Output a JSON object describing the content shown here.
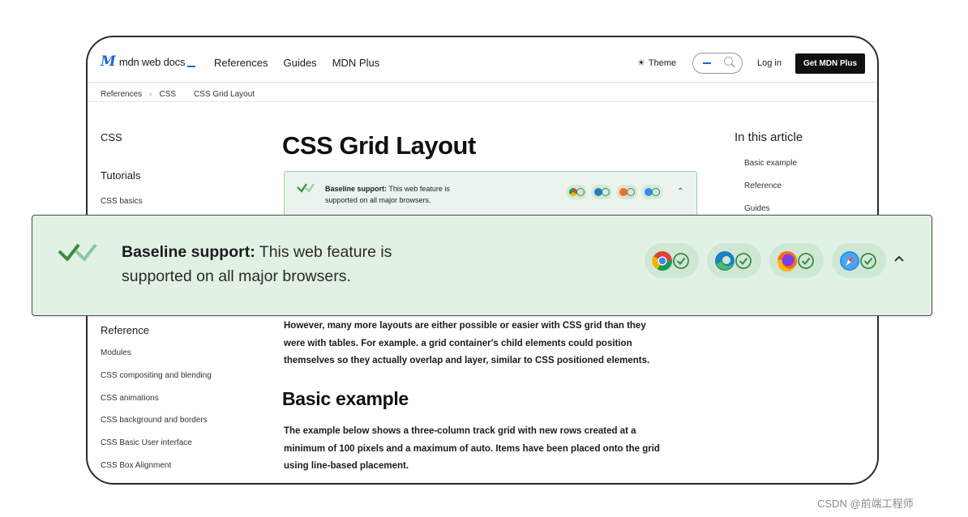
{
  "header": {
    "logo_text": "mdn web docs",
    "nav": [
      "References",
      "Guides",
      "MDN Plus"
    ],
    "theme_label": "Theme",
    "login_label": "Log in",
    "get_plus_label": "Get MDN Plus"
  },
  "breadcrumb": [
    "References",
    "CSS",
    "CSS Grid Layout"
  ],
  "sidebar": {
    "headings": [
      "CSS",
      "Tutorials"
    ],
    "basics": "CSS basics",
    "reference_heading": "Reference",
    "items": [
      "Modules",
      "CSS compositing and blending",
      "CSS animations",
      "CSS background and borders",
      "CSS Basic User interface",
      "CSS Box Alignment"
    ]
  },
  "main": {
    "title": "CSS Grid Layout",
    "baseline_bold": "Baseline support:",
    "baseline_rest_1": "This web feature is",
    "baseline_rest_2": "supported on all major browsers.",
    "para1": [
      "However, many more layouts are either possible or easier with CSS grid than they",
      "were with tables. For example. a grid container's child elements could position",
      "themselves so they actually overlap and layer, similar to CSS positioned elements."
    ],
    "h2": "Basic example",
    "para2": [
      "The example below shows a three-column track grid with new rows created at a",
      "minimum of 100 pixels and a maximum of auto. Items have been placed onto the grid",
      "using line-based placement."
    ]
  },
  "toc": {
    "heading": "In this article",
    "items": [
      "Basic example",
      "Reference",
      "Guides"
    ]
  },
  "banner": {
    "bold": "Baseline support:",
    "line1_rest": "This web feature is",
    "line2": "supported on all major browsers.",
    "browsers": [
      "chrome-icon",
      "edge-icon",
      "firefox-icon",
      "safari-icon"
    ]
  },
  "watermark": "CSDN @前端工程师",
  "colors": {
    "accent": "#1a66d9",
    "banner_bg": "#e1f2e4",
    "badge_bg": "#cfe8d4",
    "check_green": "#3a8a45"
  }
}
